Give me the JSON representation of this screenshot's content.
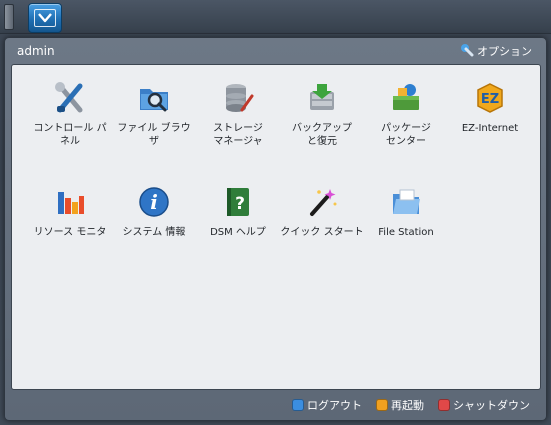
{
  "user": "admin",
  "options_label": "オプション",
  "apps": [
    {
      "label": "コントロール パ\nネル",
      "icon": "control-panel-icon"
    },
    {
      "label": "ファイル ブラウ\nザ",
      "icon": "file-browser-icon"
    },
    {
      "label": "ストレージ\nマネージャ",
      "icon": "storage-manager-icon"
    },
    {
      "label": "バックアップ\nと復元",
      "icon": "backup-restore-icon"
    },
    {
      "label": "パッケージ\nセンター",
      "icon": "package-center-icon"
    },
    {
      "label": "EZ-Internet",
      "icon": "ez-internet-icon"
    },
    {
      "label": "リソース モニタ",
      "icon": "resource-monitor-icon"
    },
    {
      "label": "システム 情報",
      "icon": "system-info-icon"
    },
    {
      "label": "DSM ヘルプ",
      "icon": "dsm-help-icon"
    },
    {
      "label": "クイック スタート",
      "icon": "quick-start-icon"
    },
    {
      "label": "File Station",
      "icon": "file-station-icon"
    }
  ],
  "footer": {
    "logout": {
      "label": "ログアウト",
      "color": "#3b8ee0"
    },
    "restart": {
      "label": "再起動",
      "color": "#f0a020"
    },
    "shutdown": {
      "label": "シャットダウン",
      "color": "#e04848"
    }
  }
}
